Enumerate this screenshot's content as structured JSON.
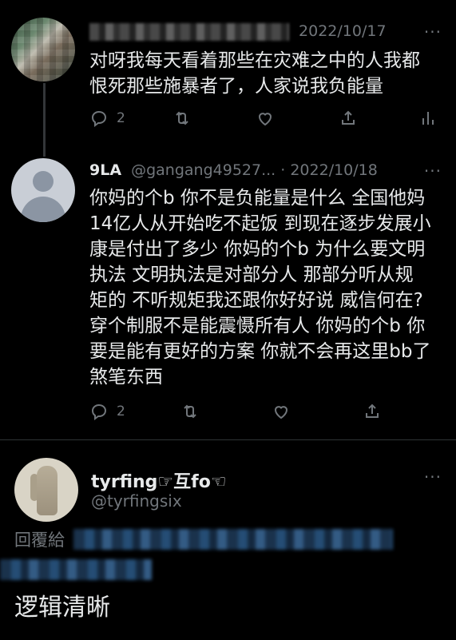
{
  "tweets": [
    {
      "author_handle_hidden": true,
      "date": "2022/10/17",
      "text_lines": [
        "对呀我每天看着那些在灾难之中的人我都",
        "恨死那些施暴者了，人家说我负能量"
      ],
      "reply_count": "2",
      "more": "···"
    },
    {
      "name": "9LA",
      "handle": "@gangang49527...",
      "sep": " · ",
      "date": "2022/10/18",
      "text_lines": [
        "你妈的个b 你不是负能量是什么 全国他妈",
        "14亿人从开始吃不起饭 到现在逐步发展小",
        "康是付出了多少 你妈的个b 为什么要文明",
        "执法 文明执法是对部分人 那部分听从规",
        "矩的 不听规矩我还跟你好好说 威信何在?",
        "穿个制服不是能震慑所有人 你妈的个b 你",
        "要是能有更好的方案 你就不会再这里bb了",
        "煞笔东西"
      ],
      "reply_count": "2",
      "more": "···"
    }
  ],
  "main": {
    "name": "tyrfing☞互fo☜",
    "handle": "@tyrfingsix",
    "more": "···",
    "replying_to_label": "回覆給",
    "text": "逻辑清晰"
  },
  "icons": {
    "reply": "reply-icon",
    "retweet": "retweet-icon",
    "like": "like-icon",
    "share": "share-icon",
    "analytics": "analytics-icon"
  },
  "colors": {
    "background": "#000000",
    "text": "#e7e9ea",
    "muted": "#71767b",
    "divider": "#2f3336"
  }
}
